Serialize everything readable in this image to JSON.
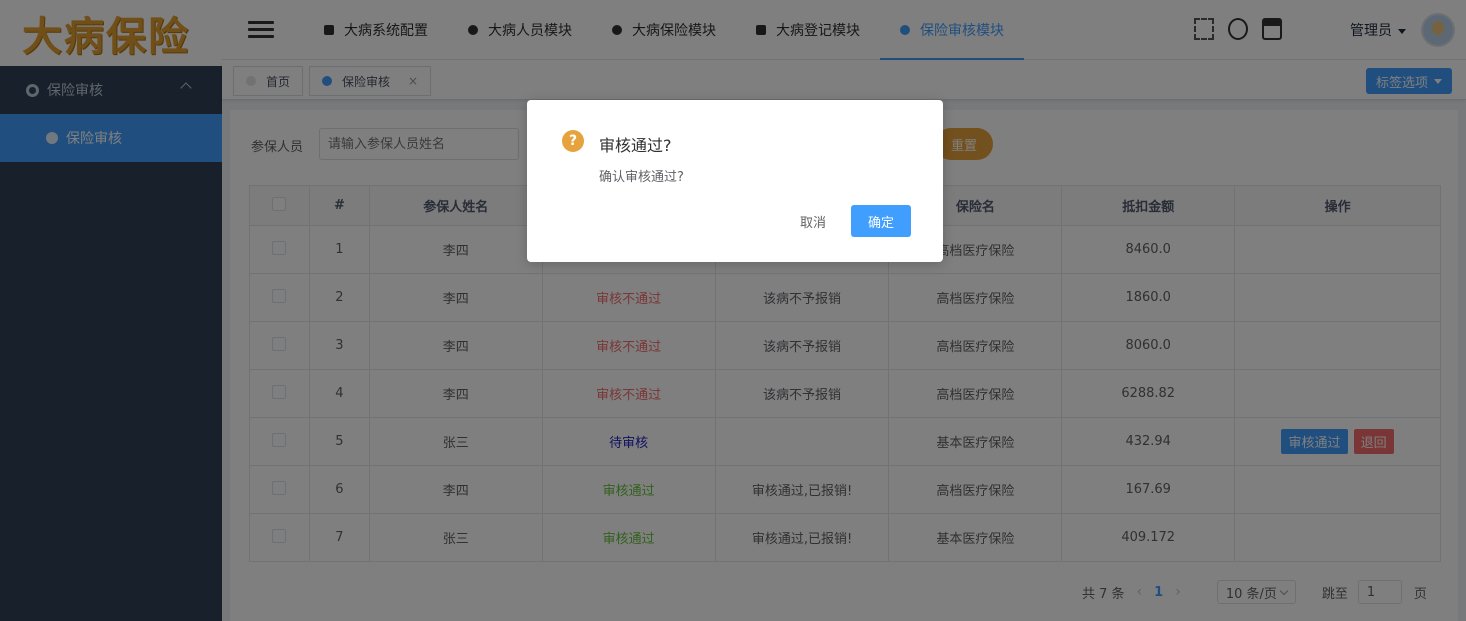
{
  "sidebar": {
    "logo_text": "大病保险",
    "group": {
      "label": "保险审核",
      "icon": "circle-icon"
    },
    "items": [
      {
        "label": "保险审核",
        "icon": "baseball-icon"
      }
    ]
  },
  "topbar": {
    "menu_icon": "hamburger-icon",
    "tabs": [
      {
        "label": "大病系统配置",
        "icon": "home-icon"
      },
      {
        "label": "大病人员模块",
        "icon": "circle-icon"
      },
      {
        "label": "大病保险模块",
        "icon": "clock-icon"
      },
      {
        "label": "大病登记模块",
        "icon": "chart-icon"
      },
      {
        "label": "保险审核模块",
        "icon": "cloud-icon"
      }
    ],
    "user_name": "管理员"
  },
  "tags": {
    "items": [
      {
        "label": "首页"
      },
      {
        "label": "保险审核"
      }
    ],
    "close": "×",
    "options_label": "标签选项"
  },
  "search": {
    "label": "参保人员",
    "placeholder": "请输入参保人员姓名",
    "reset_label": "重置"
  },
  "table": {
    "headers": [
      "#",
      "参保人姓名",
      "",
      "",
      "保险名",
      "抵扣金额",
      "操作"
    ],
    "rows": [
      {
        "no": "1",
        "name": "李四",
        "status": "",
        "remark": "",
        "insurance": "高档医疗保险",
        "amount": "8460.0"
      },
      {
        "no": "2",
        "name": "李四",
        "status": "审核不通过",
        "remark": "该病不予报销",
        "insurance": "高档医疗保险",
        "amount": "1860.0"
      },
      {
        "no": "3",
        "name": "李四",
        "status": "审核不通过",
        "remark": "该病不予报销",
        "insurance": "高档医疗保险",
        "amount": "8060.0"
      },
      {
        "no": "4",
        "name": "李四",
        "status": "审核不通过",
        "remark": "该病不予报销",
        "insurance": "高档医疗保险",
        "amount": "6288.82"
      },
      {
        "no": "5",
        "name": "张三",
        "status": "待审核",
        "remark": "",
        "insurance": "基本医疗保险",
        "amount": "432.94",
        "actions": [
          "审核通过",
          "退回"
        ]
      },
      {
        "no": "6",
        "name": "李四",
        "status": "审核通过",
        "remark": "审核通过,已报销!",
        "insurance": "高档医疗保险",
        "amount": "167.69"
      },
      {
        "no": "7",
        "name": "张三",
        "status": "审核通过",
        "remark": "审核通过,已报销!",
        "insurance": "基本医疗保险",
        "amount": "409.172"
      }
    ]
  },
  "pagination": {
    "total": "共 7 条",
    "prev": "‹",
    "page": "1",
    "next": "›",
    "page_size": "10 条/页",
    "jump_label": "跳至",
    "jump_value": "1",
    "page_suffix": "页"
  },
  "dialog": {
    "icon": "question-icon",
    "icon_glyph": "?",
    "title": "审核通过?",
    "message": "确认审核通过?",
    "cancel_label": "取消",
    "confirm_label": "确定"
  },
  "colors": {
    "primary": "#409eff",
    "warning": "#e6a23c",
    "danger": "#f56c6c",
    "success": "#67c23a",
    "pending": "#1e1ebe",
    "sidebar": "#304156"
  }
}
